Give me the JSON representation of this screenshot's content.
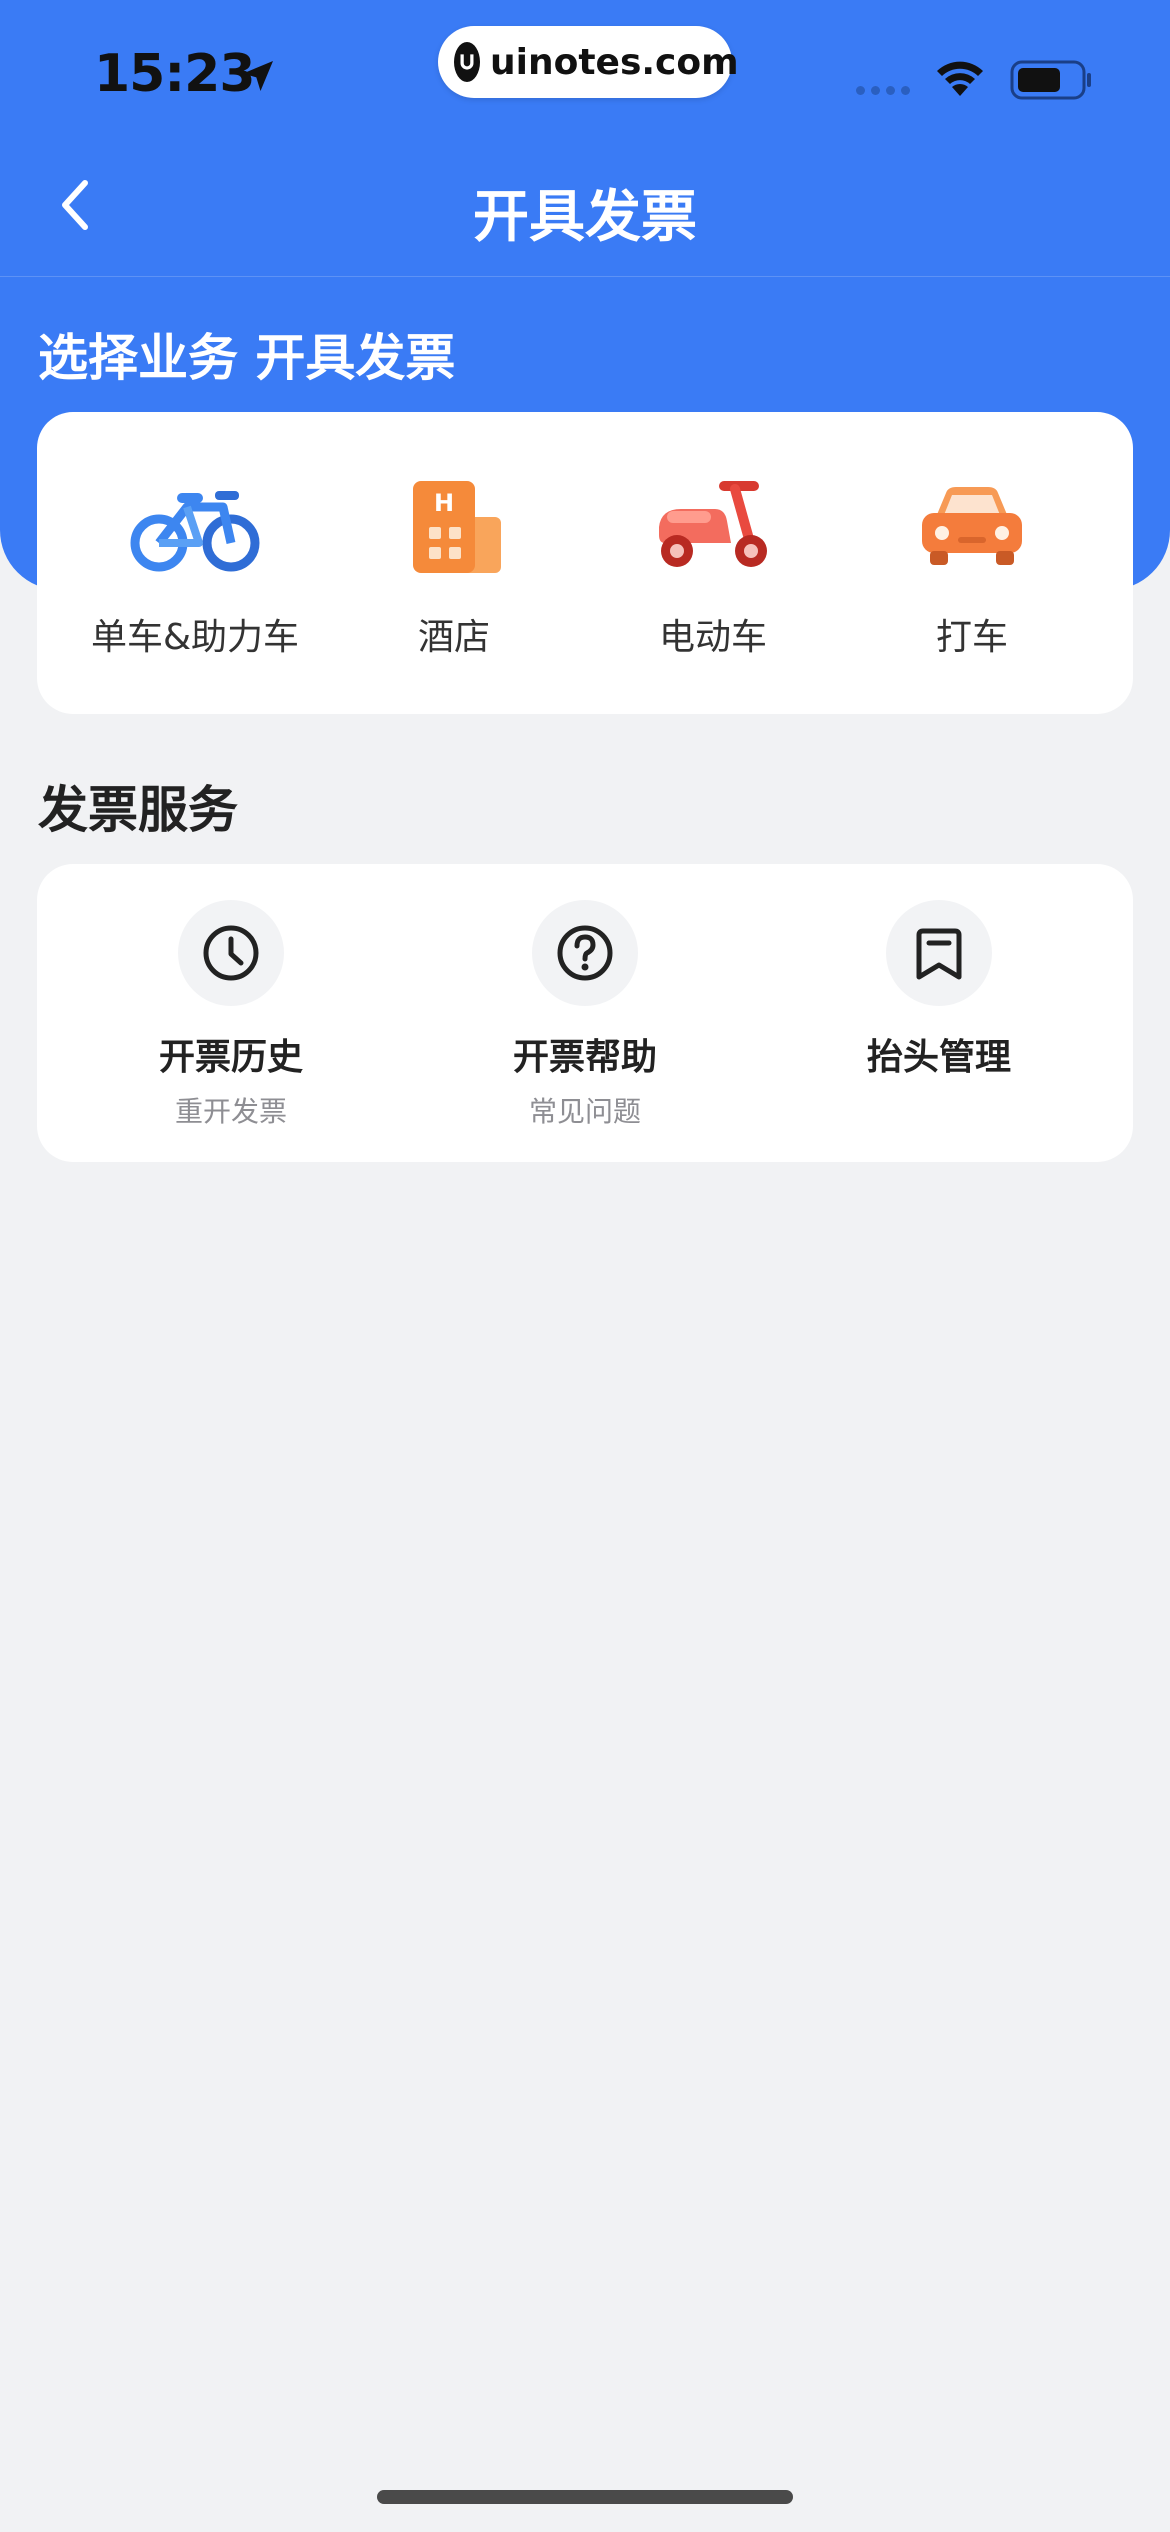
{
  "status_bar": {
    "time": "15:23",
    "url": "uinotes.com"
  },
  "nav": {
    "title": "开具发票"
  },
  "business_section": {
    "title": "选择业务 开具发票",
    "items": [
      {
        "label": "单车&助力车",
        "icon": "bicycle-icon"
      },
      {
        "label": "酒店",
        "icon": "hotel-icon"
      },
      {
        "label": "电动车",
        "icon": "scooter-icon"
      },
      {
        "label": "打车",
        "icon": "car-icon"
      }
    ]
  },
  "service_section": {
    "title": "发票服务",
    "items": [
      {
        "title": "开票历史",
        "subtitle": "重开发票",
        "icon": "clock-icon"
      },
      {
        "title": "开票帮助",
        "subtitle": "常见问题",
        "icon": "question-icon"
      },
      {
        "title": "抬头管理",
        "subtitle": "",
        "icon": "bookmark-icon"
      }
    ]
  },
  "colors": {
    "header_blue": "#3A7BF5",
    "page_bg": "#F1F2F4",
    "bike_blue": "#3D86F0",
    "hotel_orange": "#F58A3A",
    "scooter_red": "#E94A3F",
    "car_orange": "#F47C3C"
  }
}
